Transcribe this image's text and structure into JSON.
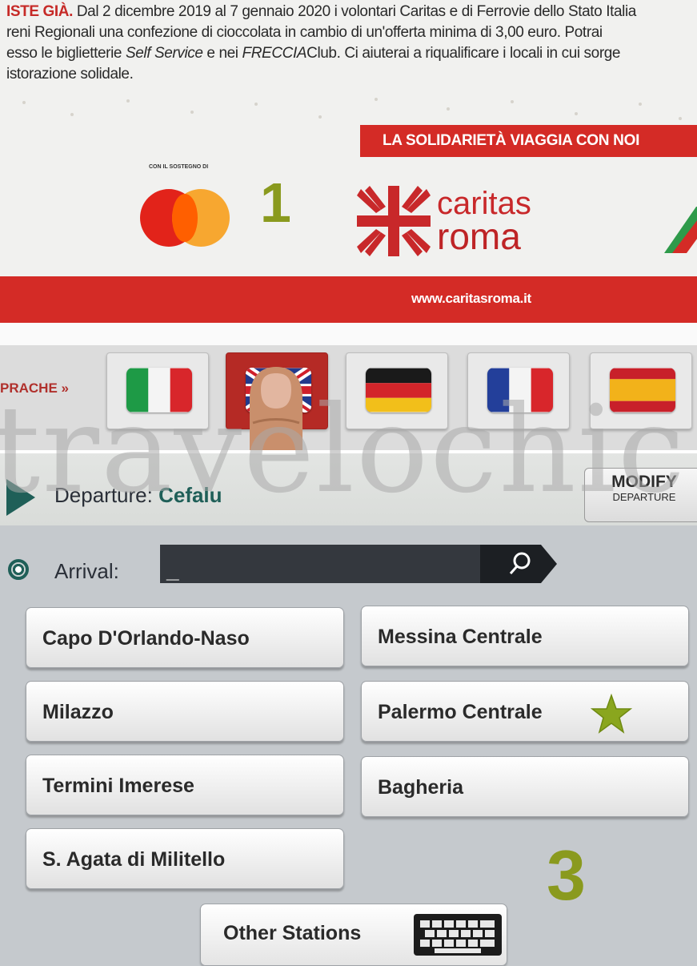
{
  "top_panel": {
    "intro_lines": [
      {
        "highlight": "ISTE GIÀ.",
        "text": " Dal 2 dicembre 2019 al 7 gennaio 2020 i volontari Caritas e di Ferrovie dello Stato Italia"
      },
      {
        "text": "reni Regionali una confezione di cioccolata in cambio di un'offerta minima di 3,00 euro. Potrai"
      },
      {
        "pre": "esso le biglietterie ",
        "italic1": "Self Service",
        "mid": " e nei ",
        "italic2": "FRECCIA",
        "post": "Club. Ci aiuterai a riqualificare i locali in cui sorge"
      },
      {
        "text": "istorazione solidale."
      }
    ],
    "banner": "LA SOLIDARIETÀ VIAGGIA CON NOI",
    "sponsor_label": "CON IL SOSTEGNO DI",
    "step_number": "1",
    "caritas_line1": "caritas",
    "caritas_line2": "roma",
    "website": "www.caritasroma.it",
    "languages_label": "PRACHE »",
    "languages": [
      {
        "name": "italian-flag",
        "selected": false
      },
      {
        "name": "english-flag",
        "selected": true
      },
      {
        "name": "german-flag",
        "selected": false
      },
      {
        "name": "french-flag",
        "selected": false
      },
      {
        "name": "spanish-flag",
        "selected": false
      }
    ],
    "colors": {
      "accent_red": "#d42b26",
      "step_green": "#8a9a1e"
    }
  },
  "watermark": "travelochic",
  "bottom_panel": {
    "departure_label": "Departure:",
    "departure_value": "Cefalu",
    "modify_line1": "MODIFY",
    "modify_line2": "DEPARTURE",
    "arrival_label": "Arrival:",
    "arrival_value": "_",
    "stations": [
      {
        "label": "Capo D'Orlando-Naso"
      },
      {
        "label": "Messina Centrale"
      },
      {
        "label": "Milazzo"
      },
      {
        "label": "Palermo Centrale",
        "starred": true
      },
      {
        "label": "Termini Imerese"
      },
      {
        "label": "Bagheria"
      },
      {
        "label": "S. Agata di Militello"
      }
    ],
    "step_number": "3",
    "other_stations": "Other Stations",
    "icons": [
      "search-icon",
      "keyboard-icon",
      "star-icon",
      "play-arrow-icon"
    ]
  }
}
